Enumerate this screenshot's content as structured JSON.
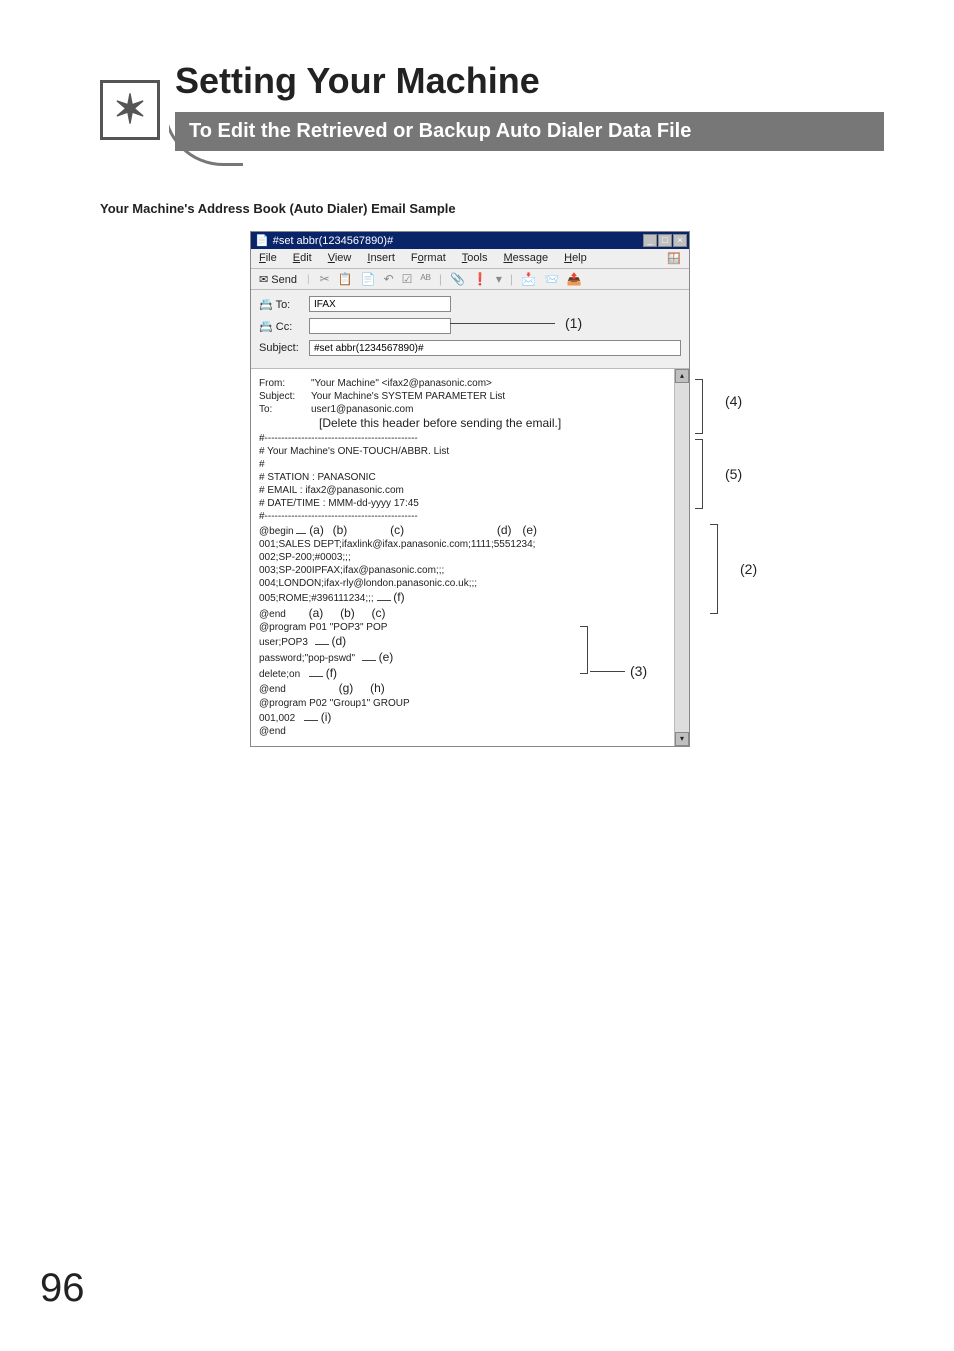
{
  "header": {
    "title": "Setting Your Machine",
    "subtitle": "To Edit the Retrieved or Backup Auto Dialer Data File",
    "logo_glyph": "✶"
  },
  "sub_heading": "Your Machine's Address Book (Auto Dialer) Email Sample",
  "email_window": {
    "title": "#set abbr(1234567890)#",
    "menu": {
      "file": "File",
      "edit": "Edit",
      "view": "View",
      "insert": "Insert",
      "format": "Format",
      "tools": "Tools",
      "message": "Message",
      "help": "Help"
    },
    "send_label": "Send",
    "fields": {
      "to_label": "To:",
      "to_value": "IFAX",
      "cc_label": "Cc:",
      "cc_value": "",
      "subject_label": "Subject:",
      "subject_value": "#set abbr(1234567890)#"
    },
    "body": {
      "from_label": "From:",
      "from_value": "\"Your Machine\" <ifax2@panasonic.com>",
      "subject_label": "Subject:",
      "subject_value": "Your Machine's SYSTEM PARAMETER List",
      "to_label": "To:",
      "to_value": "user1@panasonic.com",
      "delete_header": "[Delete this header before sending the email.]",
      "sep": "#----------------------------------------------",
      "list_title": "#  Your Machine's ONE-TOUCH/ABBR. List",
      "hash": "#",
      "station": "# STATION      : PANASONIC",
      "email": "# EMAIL           : ifax2@panasonic.com",
      "datetime": "# DATE/TIME  : MMM-dd-yyyy 17:45",
      "begin": "@begin",
      "row_header_a": "(a)",
      "row_header_b": "(b)",
      "row_header_c": "(c)",
      "row_header_d": "(d)",
      "row_header_e": "(e)",
      "row1": "001;SALES DEPT;ifaxlink@ifax.panasonic.com;1111;5551234;",
      "row2": "002;SP-200;#0003;;;",
      "row3": "003;SP-200IPFAX;ifax@panasonic.com;;;",
      "row4": "004;LONDON;ifax-rly@london.panasonic.co.uk;;;",
      "row5": "005;ROME;#396111234;;;",
      "row5_f": "(f)",
      "end1": "@end",
      "end1_a": "(a)",
      "end1_b": "(b)",
      "end1_c": "(c)",
      "prog1": "@program P01 \"POP3\" POP",
      "user": "user;POP3",
      "user_d": "(d)",
      "password": "password;\"pop-pswd\"",
      "password_e": "(e)",
      "delete": "delete;on",
      "delete_f": "(f)",
      "end2": "@end",
      "end2_g": "(g)",
      "end2_h": "(h)",
      "prog2": "@program P02 \"Group1\" GROUP",
      "group_members": "001,002",
      "group_i": "(i)",
      "end3": "@end"
    }
  },
  "callouts": {
    "c1": "(1)",
    "c2": "(2)",
    "c3": "(3)",
    "c4": "(4)",
    "c5": "(5)"
  },
  "page_number": "96"
}
